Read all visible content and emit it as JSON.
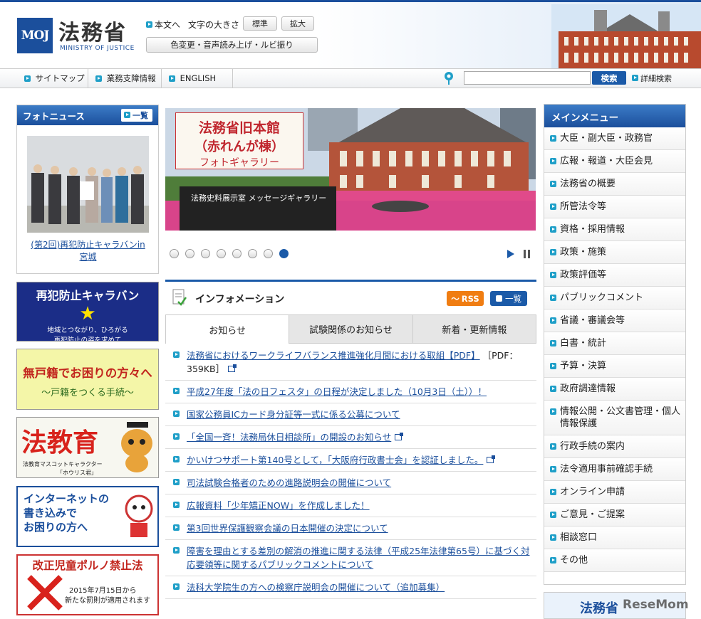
{
  "header": {
    "logo_mark": "MOJ",
    "site_name": "法務省",
    "site_name_en": "MINISTRY OF JUSTICE",
    "skip_link": "本文へ",
    "font_size_label": "文字の大きさ",
    "font_size_standard": "標準",
    "font_size_large": "拡大",
    "accessibility_label": "色変更・音声読み上げ・ルビ振り"
  },
  "nav": {
    "items": [
      {
        "label": "サイトマップ"
      },
      {
        "label": "業務支障情報"
      },
      {
        "label": "ENGLISH"
      }
    ],
    "search": {
      "placeholder": "",
      "button": "検索",
      "advanced": "詳細検索"
    }
  },
  "photo_news": {
    "title": "フォトニュース",
    "all_label": "一覧",
    "caption": "(第2回)再犯防止キャラバンin 宮城"
  },
  "banners": [
    {
      "line1": "再犯防止キャラバン",
      "line2": "地域とつながり、ひろがる",
      "line3": "再犯防止の姿を求めて"
    },
    {
      "line1": "無戸籍でお困りの方々へ",
      "line2": "～戸籍をつくる手続～"
    },
    {
      "line1": "法教育",
      "line2": "法教育マスコットキャラクター",
      "line3": "「ホウリス君」"
    },
    {
      "line1": "インターネットの",
      "line2": "書き込みで",
      "line3": "お困りの方へ"
    },
    {
      "line1": "改正児童ポルノ禁止法",
      "line2": "2015年7月15日から",
      "line3": "新たな罰則が適用されます"
    }
  ],
  "slider": {
    "title_line1": "法務省旧本館",
    "title_line2": "（赤れんが棟）",
    "title_line3": "フォトギャラリー",
    "sign_text": "法務史料展示室 メッセージギャラリー",
    "dots": 8,
    "active_dot": 8
  },
  "info": {
    "title": "インフォメーション",
    "rss_label": "RSS",
    "all_label": "一覧",
    "tabs": [
      "お知らせ",
      "試験関係のお知らせ",
      "新着・更新情報"
    ],
    "items": [
      {
        "text": "法務省におけるワークライフバランス推進強化月間における取組【PDF】",
        "suffix": "［PDF：359KB］",
        "external": true
      },
      {
        "text": "平成27年度「法の日フェスタ」の日程が決定しました（10月3日（土））！",
        "suffix": "",
        "external": false
      },
      {
        "text": "国家公務員ICカード身分証等一式に係る公募について",
        "suffix": "",
        "external": false
      },
      {
        "text": "「全国一斉！法務局休日相談所」の開設のお知らせ",
        "suffix": "",
        "external": true
      },
      {
        "text": "かいけつサポート第140号として，「大阪府行政書士会」を認証しました。",
        "suffix": "",
        "external": true
      },
      {
        "text": "司法試験合格者のための進路説明会の開催について",
        "suffix": "",
        "external": false
      },
      {
        "text": "広報資料「少年矯正NOW」を作成しました！",
        "suffix": "",
        "external": false
      },
      {
        "text": "第3回世界保護観察会議の日本開催の決定について",
        "suffix": "",
        "external": false
      },
      {
        "text": "障害を理由とする差別の解消の推進に関する法律（平成25年法律第65号）に基づく対応要領等に関するパブリックコメントについて",
        "suffix": "",
        "external": false
      },
      {
        "text": "法科大学院生の方への検察庁説明会の開催について（追加募集）",
        "suffix": "",
        "external": false
      }
    ]
  },
  "main_menu": {
    "title": "メインメニュー",
    "items": [
      "大臣・副大臣・政務官",
      "広報・報道・大臣会見",
      "法務省の概要",
      "所管法令等",
      "資格・採用情報",
      "政策・施策",
      "政策評価等",
      "パブリックコメント",
      "省議・審議会等",
      "白書・統計",
      "予算・決算",
      "政府調達情報",
      "情報公開・公文書管理・個人情報保護",
      "行政手続の案内",
      "法令適用事前確認手続",
      "オンライン申請",
      "ご意見・ご提案",
      "相談窓口",
      "その他"
    ]
  },
  "bottom_banner": {
    "text": "法務省"
  },
  "watermark": "ReseMom",
  "colors": {
    "primary": "#1b4f9c",
    "accent": "#1f9fc8",
    "rss": "#f07d12"
  }
}
